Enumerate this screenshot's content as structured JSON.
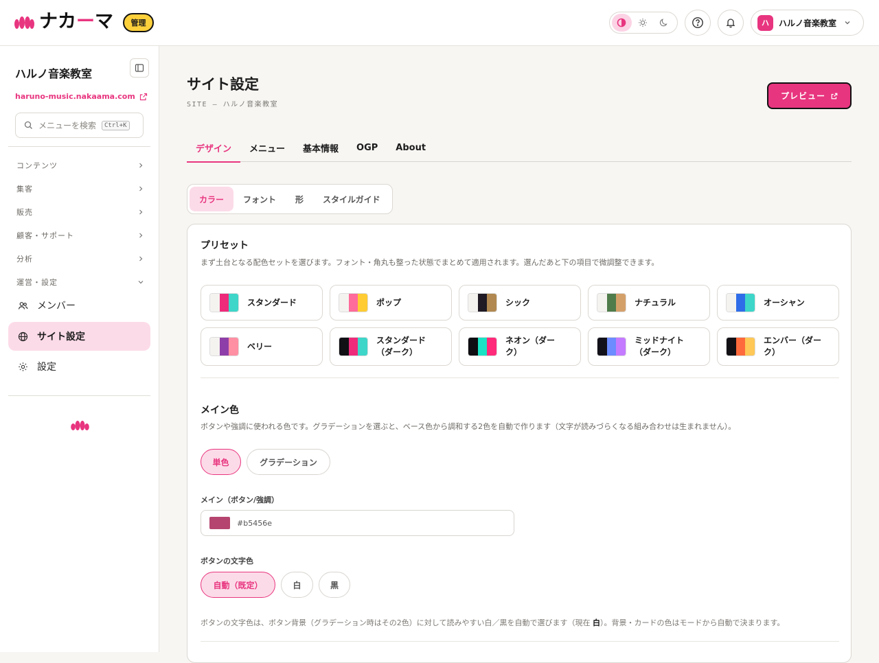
{
  "header": {
    "logo_text": "ナカーマ",
    "logo_parts": [
      "ナカ",
      "ー",
      "マ"
    ],
    "admin_badge": "管理",
    "theme_modes": [
      "contrast-icon",
      "sun-icon",
      "moon-icon"
    ],
    "account": {
      "avatar": "ハ",
      "name": "ハルノ音楽教室"
    }
  },
  "sidebar": {
    "site_name": "ハルノ音楽教室",
    "site_url": "haruno-music.nakaama.com",
    "search_placeholder": "メニューを検索",
    "search_shortcut": "Ctrl+K",
    "groups": [
      {
        "label": "コンテンツ",
        "expanded": false
      },
      {
        "label": "集客",
        "expanded": false
      },
      {
        "label": "販売",
        "expanded": false
      },
      {
        "label": "顧客・サポート",
        "expanded": false
      },
      {
        "label": "分析",
        "expanded": false
      },
      {
        "label": "運営・設定",
        "expanded": true
      }
    ],
    "items": [
      {
        "label": "メンバー",
        "icon": "members-icon"
      },
      {
        "label": "サイト設定",
        "icon": "globe-icon",
        "active": true
      },
      {
        "label": "設定",
        "icon": "gear-icon"
      }
    ]
  },
  "page": {
    "title": "サイト設定",
    "subtitle": "SITE — ハルノ音楽教室",
    "preview_button": "プレビュー",
    "tabs": [
      "デザイン",
      "メニュー",
      "基本情報",
      "OGP",
      "About"
    ],
    "active_tab": 0,
    "subtabs": [
      "カラー",
      "フォント",
      "形",
      "スタイルガイド"
    ],
    "active_subtab": 0
  },
  "presets": {
    "heading": "プリセット",
    "description": "まず土台となる配色セットを選びます。フォント・角丸も整った状態でまとめて適用されます。選んだあと下の項目で微調整できます。",
    "items": [
      {
        "name": "スタンダード",
        "colors": [
          "#f5f3f0",
          "#ee2a7b",
          "#3dd6c9"
        ]
      },
      {
        "name": "ポップ",
        "colors": [
          "#f5f3f0",
          "#ff6b9a",
          "#ffcc33"
        ]
      },
      {
        "name": "シック",
        "colors": [
          "#f5f3f0",
          "#1f1a24",
          "#b08850"
        ]
      },
      {
        "name": "ナチュラル",
        "colors": [
          "#f5f3f0",
          "#4f7c4a",
          "#d4a06a"
        ]
      },
      {
        "name": "オーシャン",
        "colors": [
          "#f5f3f0",
          "#2f6de8",
          "#3dd6c9"
        ]
      },
      {
        "name": "ベリー",
        "colors": [
          "#f5f3f0",
          "#8e3ea8",
          "#ff8fa3"
        ]
      },
      {
        "name": "スタンダード（ダーク）",
        "lines": [
          "スタンダード",
          "（ダーク）"
        ],
        "colors": [
          "#111015",
          "#ee2a7b",
          "#3dd6c9"
        ]
      },
      {
        "name": "ネオン（ダーク）",
        "lines": [
          "ネオン（ダー",
          "ク）"
        ],
        "colors": [
          "#0e0d12",
          "#19e3c4",
          "#ff2a7a"
        ]
      },
      {
        "name": "ミッドナイト（ダーク）",
        "lines": [
          "ミッドナイト",
          "（ダーク）"
        ],
        "colors": [
          "#12111a",
          "#6c8cff",
          "#c47bff"
        ]
      },
      {
        "name": "エンバー（ダーク）",
        "lines": [
          "エンバー（ダー",
          "ク）"
        ],
        "colors": [
          "#131015",
          "#ff6a3d",
          "#ffc857"
        ]
      }
    ]
  },
  "main_color": {
    "heading": "メイン色",
    "description": "ボタンや強調に使われる色です。グラデーションを選ぶと、ベース色から調和する2色を自動で作ります（文字が読みづらくなる組み合わせは生まれません）。",
    "modes": [
      "単色",
      "グラデーション"
    ],
    "active_mode": 0,
    "field_label": "メイン（ボタン/強調）",
    "value": "#b5456e",
    "button_text_label": "ボタンの文字色",
    "button_text_options": [
      "自動（既定）",
      "白",
      "黒"
    ],
    "button_text_active": 0,
    "note_before": "ボタンの文字色は、ボタン背景（グラデーション時はその2色）に対して読みやすい白／黒を自動で選びます（現在 ",
    "note_current": "白",
    "note_after": "）。背景・カードの色はモードから自動で決まります。"
  },
  "colors": {
    "accent": "#e8357f",
    "accent_soft": "#fcdbe8",
    "badge": "#fcd03b"
  }
}
